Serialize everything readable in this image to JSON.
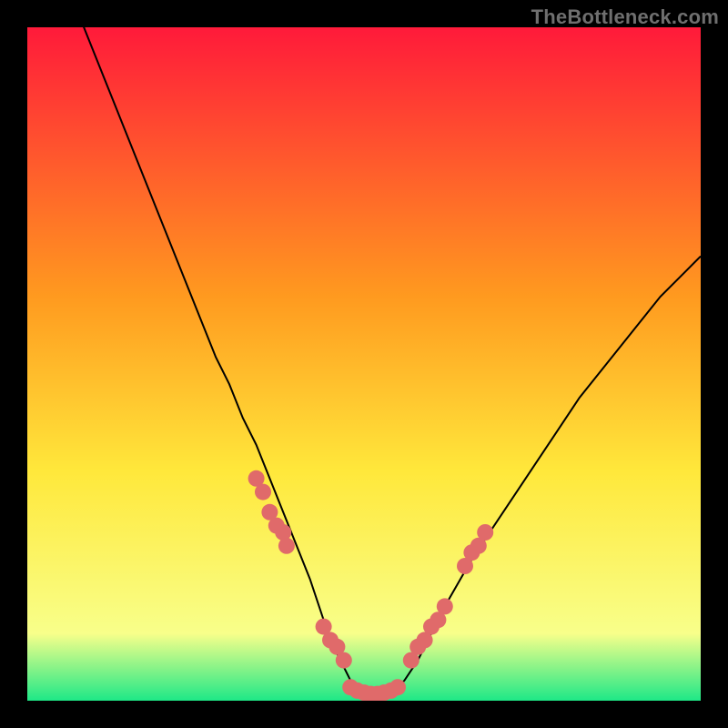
{
  "watermark": "TheBottleneck.com",
  "colors": {
    "marker": "#e06a6a",
    "curve": "#000000",
    "gradient_top": "#ff1a3a",
    "gradient_mid1": "#ff9a1f",
    "gradient_mid2": "#ffe83b",
    "gradient_mid3": "#f8ff8a",
    "gradient_bottom": "#1ee887"
  },
  "chart_data": {
    "type": "line",
    "title": "",
    "xlabel": "",
    "ylabel": "",
    "xlim": [
      0,
      100
    ],
    "ylim": [
      0,
      100
    ],
    "series": [
      {
        "name": "bottleneck-curve",
        "x": [
          8,
          10,
          12,
          14,
          16,
          18,
          20,
          22,
          24,
          26,
          28,
          30,
          32,
          34,
          36,
          38,
          40,
          42,
          44,
          46,
          48,
          50,
          52,
          54,
          56,
          58,
          60,
          62,
          66,
          70,
          74,
          78,
          82,
          86,
          90,
          94,
          98,
          100
        ],
        "values": [
          101,
          96,
          91,
          86,
          81,
          76,
          71,
          66,
          61,
          56,
          51,
          47,
          42,
          38,
          33,
          28,
          23,
          18,
          12,
          7,
          3,
          1,
          1,
          1,
          3,
          6,
          10,
          14,
          21,
          27,
          33,
          39,
          45,
          50,
          55,
          60,
          64,
          66
        ]
      }
    ],
    "scatter": [
      {
        "name": "left-cluster",
        "x": [
          34,
          35,
          36,
          37,
          38,
          38.5,
          44,
          45,
          46,
          47
        ],
        "values": [
          33,
          31,
          28,
          26,
          25,
          23,
          11,
          9,
          8,
          6
        ]
      },
      {
        "name": "bottom-cluster",
        "x": [
          48,
          49,
          50,
          51,
          52,
          53,
          54,
          55
        ],
        "values": [
          2,
          1.5,
          1.2,
          1,
          1,
          1.2,
          1.5,
          2
        ]
      },
      {
        "name": "right-cluster",
        "x": [
          57,
          58,
          59,
          60,
          61,
          62,
          65,
          66,
          67,
          68
        ],
        "values": [
          6,
          8,
          9,
          11,
          12,
          14,
          20,
          22,
          23,
          25
        ]
      }
    ]
  }
}
